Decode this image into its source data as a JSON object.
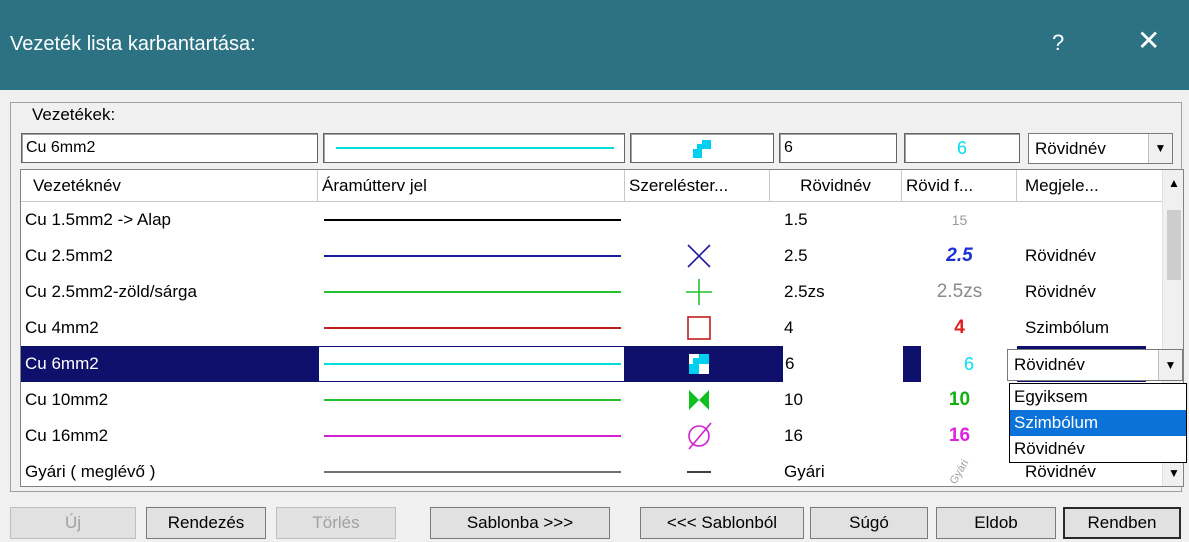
{
  "window": {
    "title": "Vezeték lista karbantartása:"
  },
  "group": {
    "label": "Vezetékek:"
  },
  "editor": {
    "name_value": "Cu 6mm2",
    "short_value": "6",
    "short_font_preview": "6",
    "display_value": "Rövidnév"
  },
  "columns": [
    "Vezetéknév",
    "Áramútterv jel",
    "Szereléster...",
    "Rövidnév",
    "Rövid f...",
    "Megjele..."
  ],
  "rows": [
    {
      "name": "Cu 1.5mm2 -> Alap",
      "line_color": "#000000",
      "symbol": "none",
      "short": "1.5",
      "preview": "15",
      "preview_color": "#9a9a9a",
      "display": ""
    },
    {
      "name": "Cu 2.5mm2",
      "line_color": "#1c1c9c",
      "symbol": "cross-icon",
      "short": "2.5",
      "preview": "2.5",
      "preview_color": "#1a2fd8",
      "display": "Rövidnév"
    },
    {
      "name": "Cu 2.5mm2-zöld/sárga",
      "line_color": "#22c22f",
      "symbol": "plus-icon",
      "short": "2.5zs",
      "preview": "2.5zs",
      "preview_color": "#8a8a8a",
      "display": "Rövidnév"
    },
    {
      "name": "Cu 4mm2",
      "line_color": "#c02020",
      "symbol": "square-icon",
      "short": "4",
      "preview": "4",
      "preview_color": "#e02020",
      "display": "Szimbólum"
    },
    {
      "name": "Cu 6mm2",
      "line_color": "#00dddd",
      "symbol": "checker-icon",
      "short": "6",
      "preview": "6",
      "preview_color": "#00e0f0",
      "display": "Rövidnév"
    },
    {
      "name": "Cu 10mm2",
      "line_color": "#22c22f",
      "symbol": "bowtie-icon",
      "short": "10",
      "preview": "10",
      "preview_color": "#10b010",
      "display": ""
    },
    {
      "name": "Cu 16mm2",
      "line_color": "#d020d0",
      "symbol": "diameter-icon",
      "short": "16",
      "preview": "16",
      "preview_color": "#e020e0",
      "display": ""
    },
    {
      "name": "Gyári ( meglévő )",
      "line_color": "#707070",
      "symbol": "dash-icon",
      "short": "Gyári",
      "preview": "Gyári",
      "preview_color": "#a0a0a0",
      "display": "Rövidnév"
    }
  ],
  "dropdown": {
    "options": [
      "Egyiksem",
      "Szimbólum",
      "Rövidnév"
    ],
    "highlighted": "Szimbólum"
  },
  "buttons": {
    "new": "Új",
    "sort": "Rendezés",
    "delete": "Törlés",
    "to_template": "Sablonba >>>",
    "from_template": "<<< Sablonból",
    "help": "Súgó",
    "discard": "Eldob",
    "ok": "Rendben"
  },
  "colors": {
    "titlebar": "#2c7283",
    "selection": "#0f0f6c",
    "highlight": "#0a72d8",
    "cyan": "#00dddd"
  }
}
